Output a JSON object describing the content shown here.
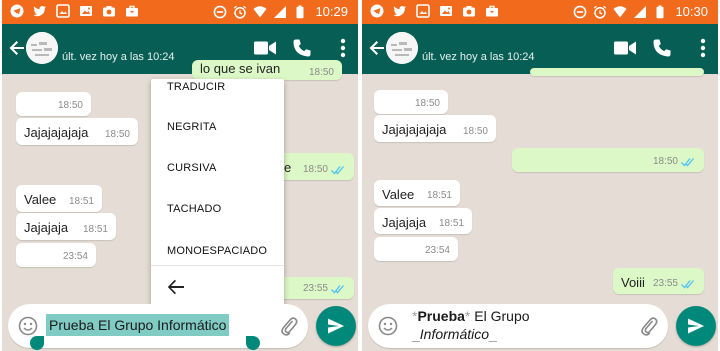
{
  "status_bar": {
    "time_left": "10:29",
    "time_right": "10:30"
  },
  "header": {
    "last_seen": "últ. vez hoy a las 10:24"
  },
  "left_screen": {
    "messages": [
      {
        "text": "lo que se ivan",
        "time": "18:50"
      },
      {
        "text": "",
        "time": "18:50"
      },
      {
        "text": "Jajajajajaja",
        "time": "18:50"
      },
      {
        "text": "e",
        "time": "18:50"
      },
      {
        "text": "Valee",
        "time": "18:51"
      },
      {
        "text": "Jajajaja",
        "time": "18:51"
      },
      {
        "text": "",
        "time": "23:54"
      },
      {
        "text": "i",
        "time": "23:55"
      }
    ],
    "text_selection_menu": {
      "items": [
        "TRADUCIR",
        "NEGRITA",
        "CURSIVA",
        "TACHADO",
        "MONOESPACIADO"
      ]
    },
    "input_text": "Prueba El Grupo Informático"
  },
  "right_screen": {
    "messages": [
      {
        "text": "",
        "time": "18:50"
      },
      {
        "text": "Jajajajajaja",
        "time": "18:50"
      },
      {
        "text": "",
        "time": "18:50"
      },
      {
        "text": "Valee",
        "time": "18:51"
      },
      {
        "text": "Jajajaja",
        "time": "18:51"
      },
      {
        "text": "",
        "time": "23:54"
      },
      {
        "text": "Voiii",
        "time": "23:55"
      }
    ],
    "input": {
      "bold_marker": "*",
      "bold_word": "Prueba",
      "line1_rest": " El Grupo",
      "italic_marker": "_",
      "italic_word": "Informático"
    }
  },
  "colors": {
    "status_bar": "#f26a1b",
    "app_bar": "#075e54",
    "chat_background": "#e5ddd5",
    "incoming_bubble": "#ffffff",
    "outgoing_bubble": "#dcf8c6",
    "accent": "#00897b",
    "selection": "#80cbc4",
    "read_ticks": "#4fc3f7"
  },
  "icons": [
    "telegram-icon",
    "twitter-icon",
    "gallery-icon",
    "image-icon",
    "camera-icon",
    "briefcase-icon",
    "block-icon",
    "alarm-icon",
    "wifi-icon",
    "signal-icon",
    "battery-icon",
    "back-arrow-icon",
    "video-call-icon",
    "phone-icon",
    "more-vert-icon",
    "emoji-icon",
    "attach-icon",
    "send-icon",
    "double-tick-icon"
  ]
}
